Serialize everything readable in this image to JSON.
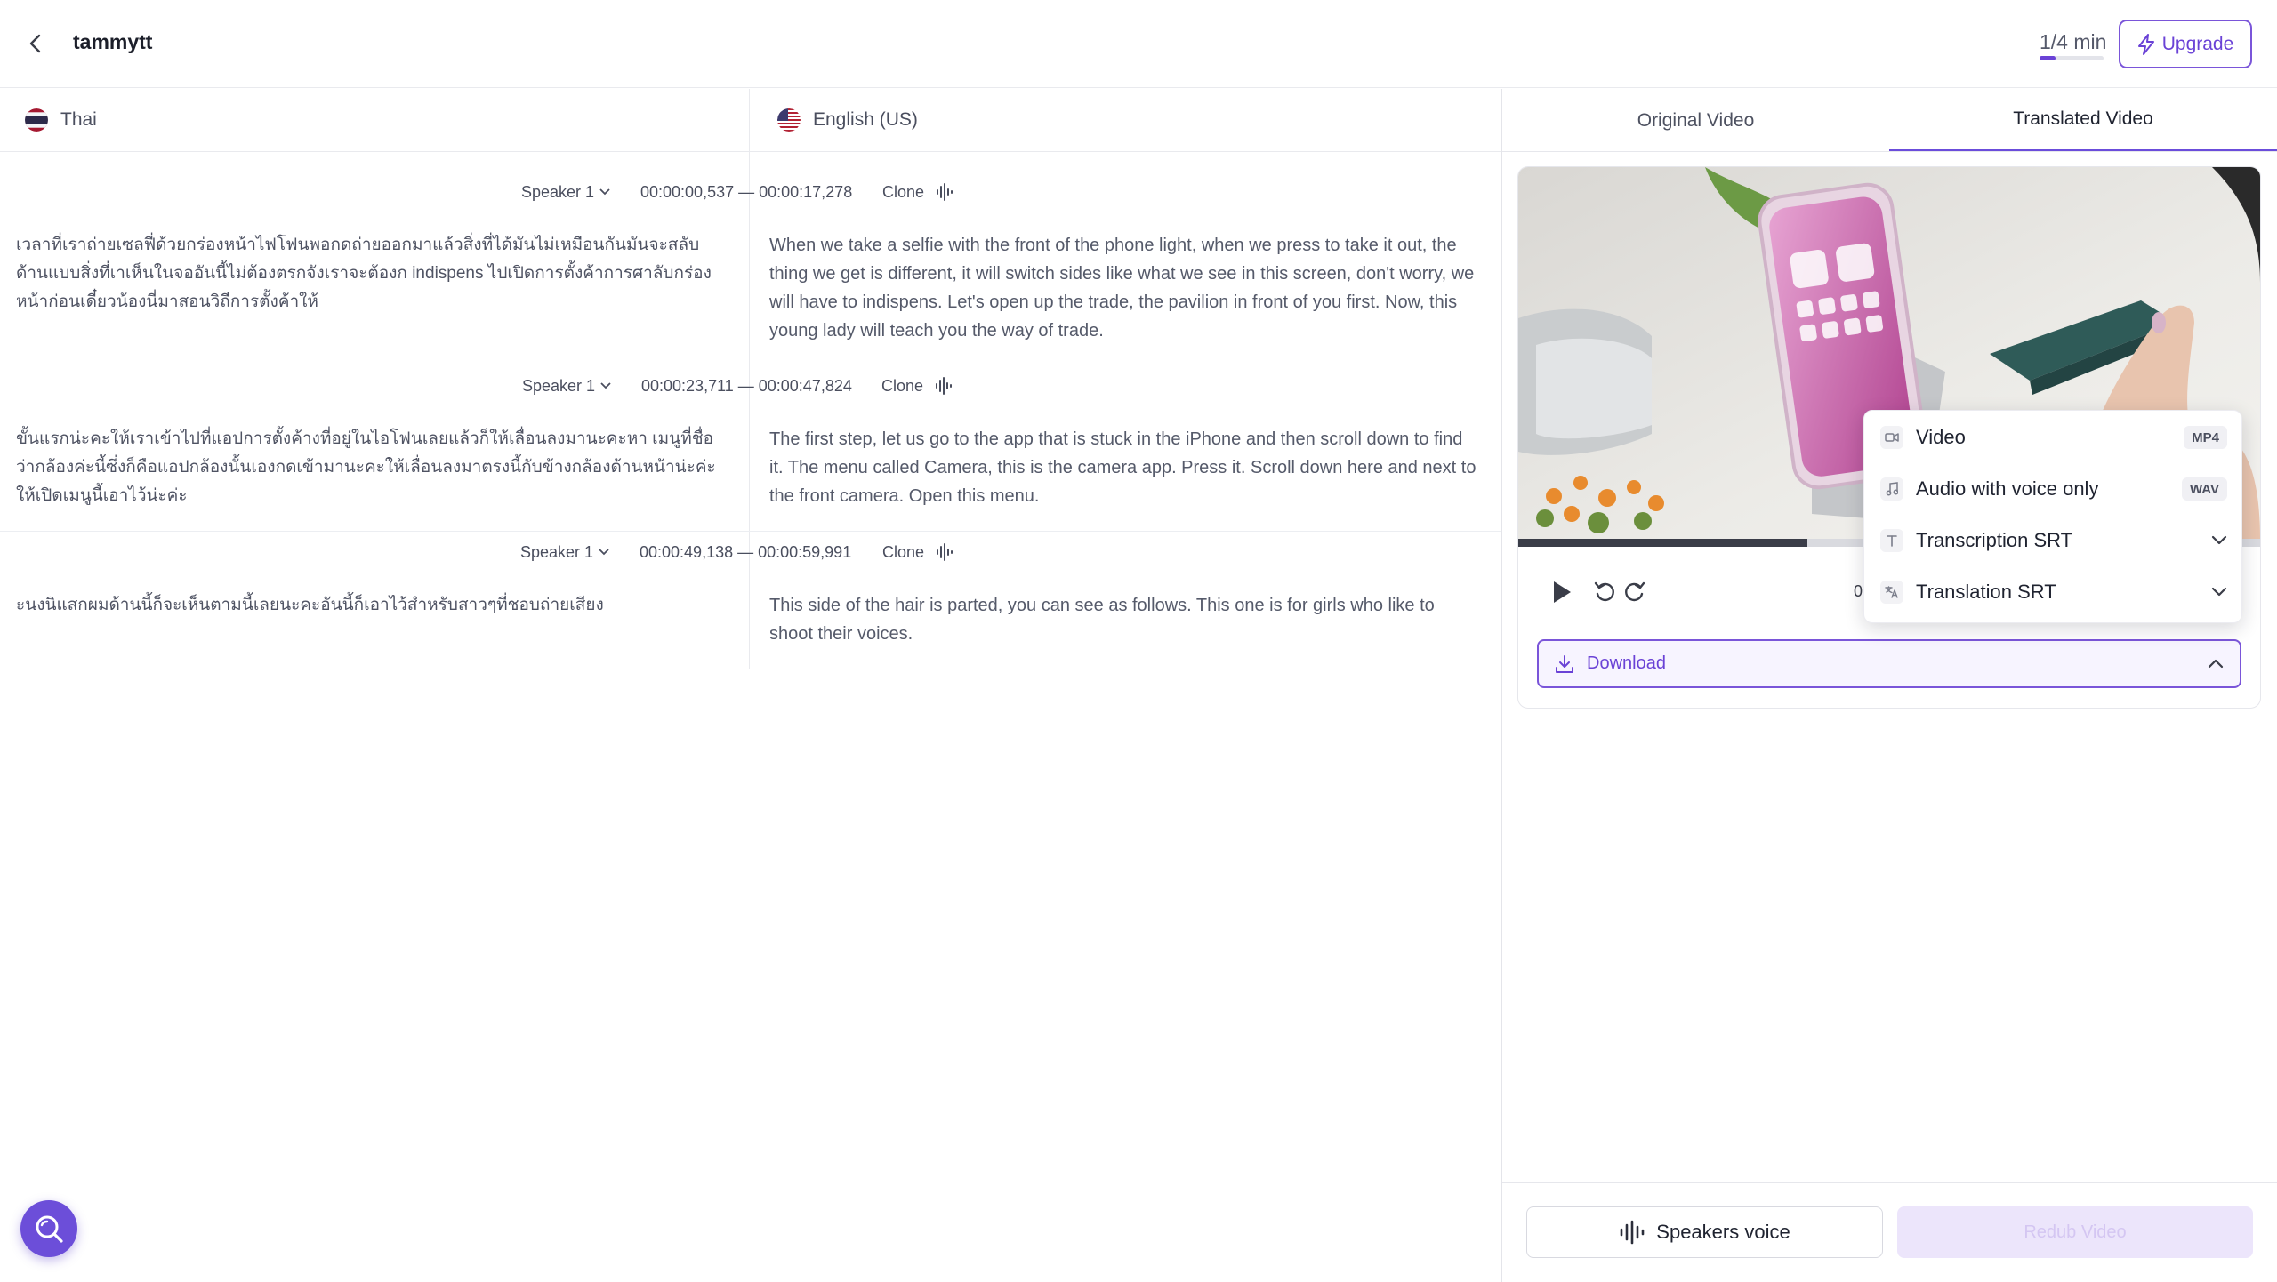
{
  "header": {
    "project_name": "tammytt",
    "quota_text": "1/4 min",
    "quota_used_fraction": 0.25,
    "upgrade_label": "Upgrade"
  },
  "languages": {
    "source": {
      "name": "Thai",
      "flag_icon": "thailand-flag-icon"
    },
    "target": {
      "name": "English (US)",
      "flag_icon": "us-flag-icon"
    }
  },
  "segments": [
    {
      "speaker": "Speaker 1",
      "timecode": "00:00:00,537 — 00:00:17,278",
      "clone_label": "Clone",
      "source_text": "เวลาที่เราถ่ายเซลฟี่ด้วยกร่องหน้าไฟโฟนพอกดถ่ายออกมาแล้วสิ่งที่ได้มันไม่เหมือนกันมันจะสลับด้านแบบสิ่งที่เาเห็นในจออันนี้ไม่ต้องตรกจังเราจะต้องก indispens ไปเปิดการตั้งค้าการศาลับกร่องหน้าก่อนเดี๋ยวน้องนี่มาสอนวิถีการตั้งค้าให้",
      "target_text": "When we take a selfie with the front of the phone light, when we press to take it out, the thing we get is different, it will switch sides like what we see in this screen, don't worry, we will have to indispens. Let's open up the trade, the pavilion in front of you first. Now, this young lady will teach you the way of trade."
    },
    {
      "speaker": "Speaker 1",
      "timecode": "00:00:23,711 — 00:00:47,824",
      "clone_label": "Clone",
      "source_text": "ขั้นแรกน่ะคะให้เราเข้าไปที่แอปการตั้งค้างที่อยู่ในไอโฟนเลยแล้วก็ให้เลื่อนลงมานะคะหา เมนูที่ชื่อว่ากล้องค่ะนี้ซึ่งก็คือแอปกล้องนั้นเองกดเข้ามานะคะให้เลื่อนลงมาตรงนี้กับข้างกล้องด้านหน้าน่ะค่ะให้เปิดเมนูนี้เอาไว้น่ะค่ะ",
      "target_text": "The first step, let us go to the app that is stuck in the iPhone and then scroll down to find it. The menu called Camera, this is the camera app. Press it. Scroll down here and next to the front camera. Open this menu."
    },
    {
      "speaker": "Speaker 1",
      "timecode": "00:00:49,138 — 00:00:59,991",
      "clone_label": "Clone",
      "source_text": "ะนงนิแสกผมด้านนี้ก็จะเห็นตามนี้เลยนะคะอันนี้ก็เอาไว้สำหรับสาวๆที่ชอบถ่ายเสียง",
      "target_text": "This side of the hair is parted, you can see as follows. This one is for girls who like to shoot their voices."
    }
  ],
  "video_panel": {
    "tabs": [
      "Original Video",
      "Translated Video"
    ],
    "active_tab": "Translated Video",
    "playback_progress": 0.39,
    "time_partial": "0",
    "download_label": "Download",
    "download_options": [
      {
        "label": "Video",
        "badge": "MP4",
        "icon": "video-camera-icon"
      },
      {
        "label": "Audio with voice only",
        "badge": "WAV",
        "icon": "music-note-icon"
      },
      {
        "label": "Transcription SRT",
        "badge": "",
        "icon": "text-t-icon"
      },
      {
        "label": "Translation SRT",
        "badge": "",
        "icon": "translate-icon"
      }
    ]
  },
  "footer": {
    "speakers_voice_label": "Speakers voice",
    "redub_label": "Redub Video"
  },
  "colors": {
    "accent": "#6a42d6",
    "accent_light": "#ece5fb",
    "text_primary": "#1f2330",
    "text_secondary": "#555a6a"
  }
}
